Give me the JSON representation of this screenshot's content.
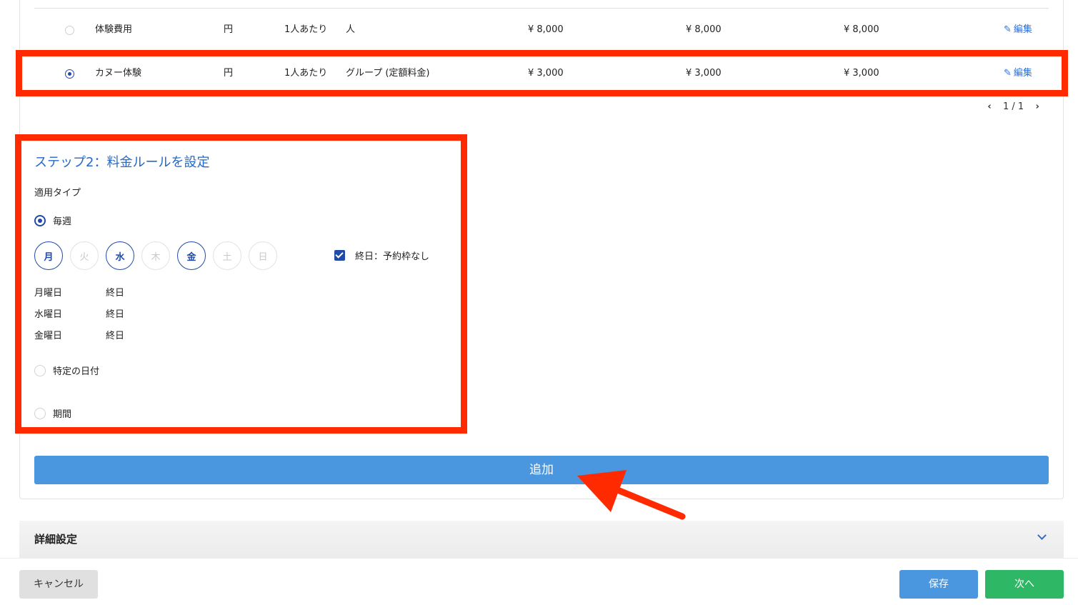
{
  "table": {
    "rows": [
      {
        "name": "体験費用",
        "currency": "円",
        "unit": "1人あたり",
        "type": "人",
        "price1": "¥ 8,000",
        "price2": "¥ 8,000",
        "price3": "¥ 8,000",
        "edit_label": "編集",
        "selected": false
      },
      {
        "name": "カヌー体験",
        "currency": "円",
        "unit": "1人あたり",
        "type": "グループ (定額料金)",
        "price1": "¥ 3,000",
        "price2": "¥ 3,000",
        "price3": "¥ 3,000",
        "edit_label": "編集",
        "selected": true
      }
    ],
    "pager": {
      "text": "1 / 1"
    }
  },
  "step2": {
    "title": "ステップ2：料金ルールを設定",
    "apply_type_label": "適用タイプ",
    "weekly_label": "毎週",
    "days": [
      {
        "label": "月",
        "on": true
      },
      {
        "label": "火",
        "on": false
      },
      {
        "label": "水",
        "on": true
      },
      {
        "label": "木",
        "on": false
      },
      {
        "label": "金",
        "on": true
      },
      {
        "label": "土",
        "on": false
      },
      {
        "label": "日",
        "on": false
      }
    ],
    "allday_label": "終日：予約枠なし",
    "schedule": [
      {
        "day": "月曜日",
        "time": "終日"
      },
      {
        "day": "水曜日",
        "time": "終日"
      },
      {
        "day": "金曜日",
        "time": "終日"
      }
    ],
    "specific_date_label": "特定の日付",
    "period_label": "期間"
  },
  "add_button": "追加",
  "detail_settings": "詳細設定",
  "footer": {
    "cancel": "キャンセル",
    "save": "保存",
    "next": "次へ"
  },
  "colors": {
    "accent": "#2468c9",
    "primary_button": "#4a97e0",
    "success_button": "#2eb865",
    "annotation": "#ff2a00"
  },
  "icons": {
    "edit": "pencil-icon",
    "prev": "chevron-left-icon",
    "next": "chevron-right-icon",
    "expand": "chevron-down-icon",
    "check": "check-icon"
  }
}
